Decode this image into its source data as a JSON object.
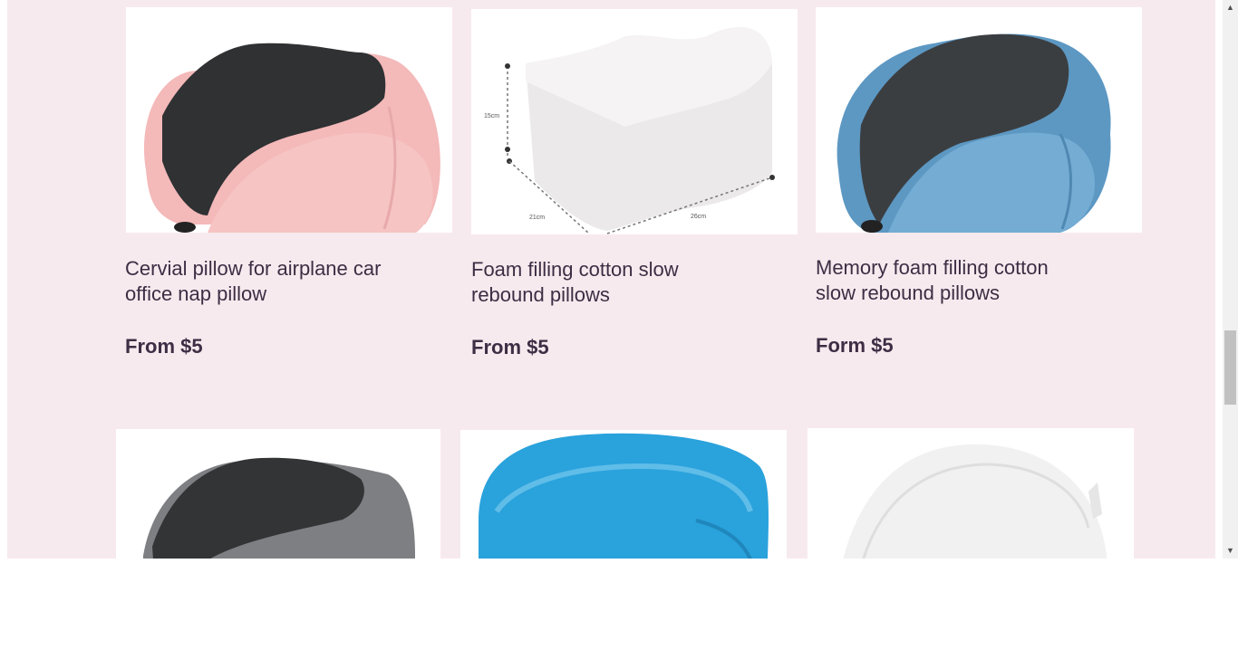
{
  "products": [
    {
      "title": "Cervial pillow for airplane car office nap pillow",
      "price": "From $5",
      "image_icon": "pink-neck-pillow-image"
    },
    {
      "title": "Foam filling cotton slow rebound pillows",
      "price": "From $5",
      "image_icon": "white-knee-pillow-image",
      "image_labels": {
        "height": "15cm",
        "width": "21cm",
        "length": "26cm"
      }
    },
    {
      "title": "Memory foam filling cotton slow rebound pillows",
      "price": "Form $5",
      "image_icon": "blue-neck-pillow-image"
    },
    {
      "image_icon": "gray-neck-pillow-image"
    },
    {
      "image_icon": "blue-folded-blanket-image"
    },
    {
      "image_icon": "white-foam-pillow-image"
    }
  ],
  "scrollbar": {
    "up_arrow": "▲",
    "down_arrow": "▼",
    "scroll_position": 0.6
  },
  "colors": {
    "page_background": "#f7eaee",
    "text": "#3e2d44"
  }
}
